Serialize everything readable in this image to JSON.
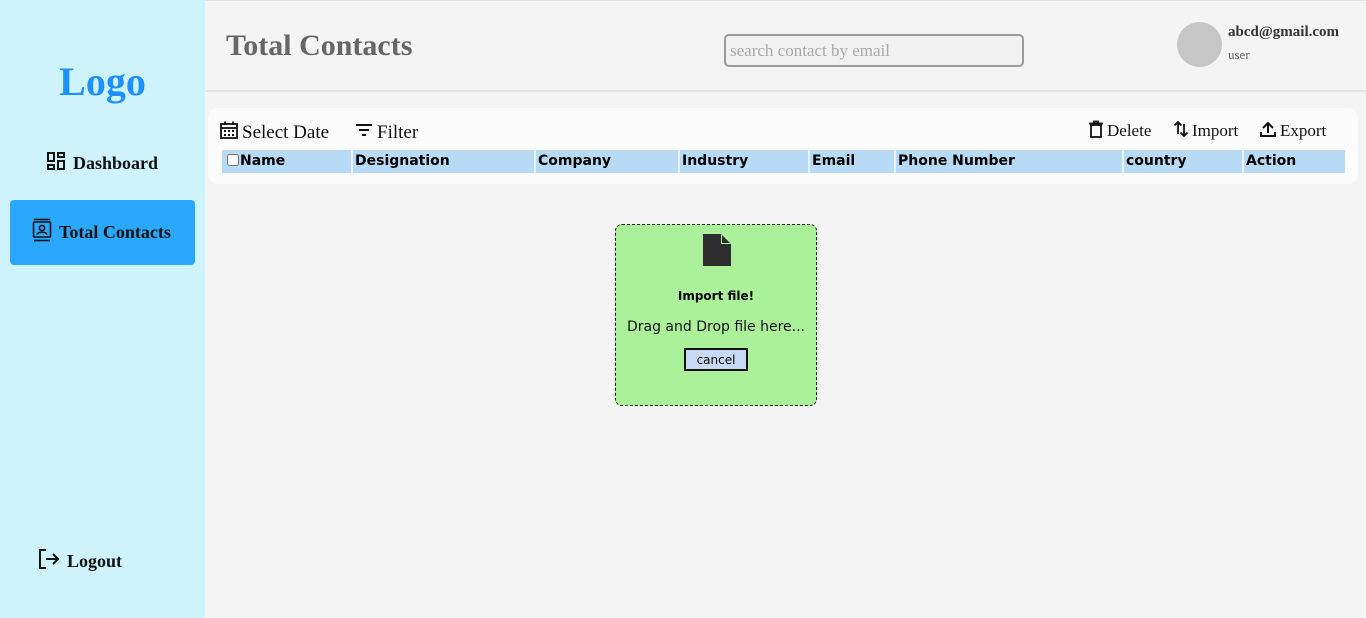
{
  "sidebar": {
    "logo": "Logo",
    "items": [
      {
        "label": "Dashboard",
        "icon": "dashboard-grid-icon"
      },
      {
        "label": "Total Contacts",
        "icon": "contact-card-icon",
        "active": true
      }
    ],
    "logout": {
      "label": "Logout",
      "icon": "logout-icon"
    }
  },
  "header": {
    "title": "Total Contacts",
    "search_placeholder": "search contact by email",
    "user": {
      "email": "abcd@gmail.com",
      "role": "user"
    }
  },
  "toolbar": {
    "select_date": "Select Date",
    "filter": "Filter",
    "delete": "Delete",
    "import": "Import",
    "export": "Export"
  },
  "table": {
    "columns": [
      "Name",
      "Designation",
      "Company",
      "Industry",
      "Email",
      "Phone Number",
      "country",
      "Action"
    ]
  },
  "import_dialog": {
    "title": "Import file!",
    "hint": "Drag and Drop file here...",
    "cancel": "cancel"
  },
  "colors": {
    "sidebar_bg": "#cef3fd",
    "logo": "#1e90ff",
    "active_nav": "#29a8fd",
    "table_header": "#b7dbf4",
    "dropzone": "#abf19a"
  }
}
